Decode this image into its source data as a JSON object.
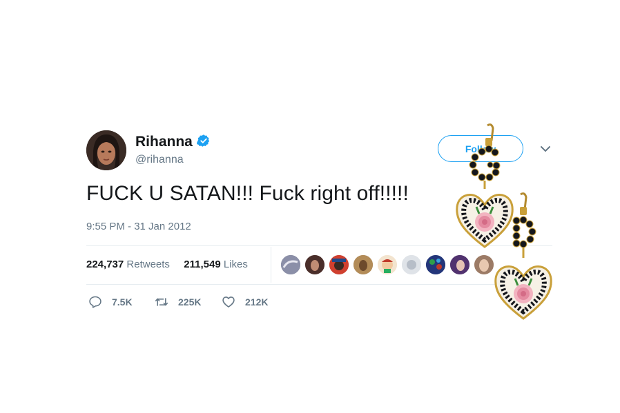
{
  "user": {
    "name": "Rihanna",
    "handle": "@rihanna",
    "verified": true
  },
  "follow_button": {
    "label": "Follow"
  },
  "tweet": {
    "text": "FUCK U SATAN!!! Fuck right off!!!!!",
    "timestamp": "9:55 PM - 31 Jan 2012"
  },
  "stats": {
    "retweets_count": "224,737",
    "retweets_label": "Retweets",
    "likes_count": "211,549",
    "likes_label": "Likes"
  },
  "actions": {
    "replies": "7.5K",
    "retweets": "225K",
    "likes": "212K"
  },
  "colors": {
    "accent": "#1da1f2",
    "muted": "#657786",
    "divider": "#e6ecf0"
  },
  "icons": [
    "verified-badge-icon",
    "chevron-down-icon",
    "reply-icon",
    "retweet-icon",
    "heart-icon"
  ]
}
